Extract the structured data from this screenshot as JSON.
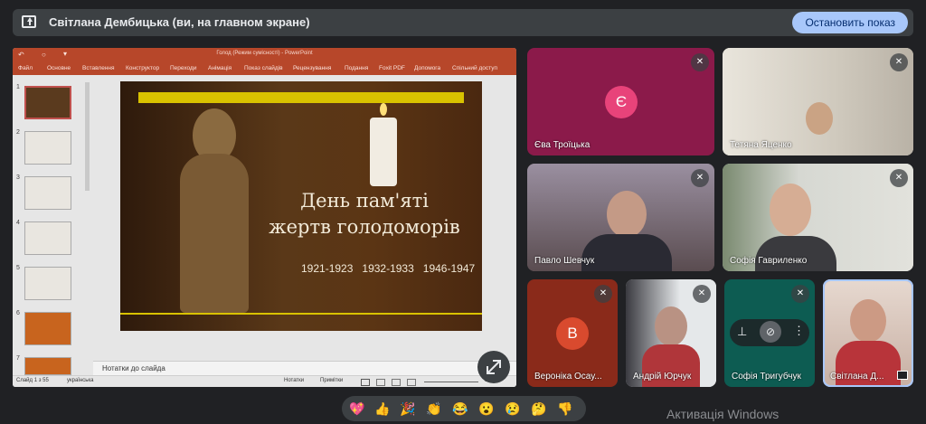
{
  "banner": {
    "text": "Світлана Дембицька (ви, на главном экране)",
    "stop_label": "Остановить показ"
  },
  "ppt": {
    "title": "Голод (Режим сумісності) - PowerPoint",
    "menu": [
      "Файл",
      "Основне",
      "Вставлення",
      "Конструктор",
      "Переходи",
      "Анімація",
      "Показ слайдів",
      "Рецензування",
      "Подання",
      "Foxit PDF",
      "Допомога",
      "Спільний доступ"
    ],
    "thumb_numbers": [
      "1",
      "2",
      "3",
      "4",
      "5",
      "6",
      "7"
    ],
    "notes_placeholder": "Нотатки до слайда",
    "status": {
      "slide_counter": "Слайд 1 з 55",
      "language": "українська",
      "notes_btn": "Нотатки",
      "comments_btn": "Примітки",
      "zoom": "52 %"
    },
    "slide": {
      "title_line1": "День пам'яті",
      "title_line2": "жертв голодоморів",
      "years": "1921-1923   1932-1933   1946-1947"
    }
  },
  "participants": [
    {
      "name": "Єва Троїцька",
      "initial": "Є",
      "muted": true
    },
    {
      "name": "Тетяна Яценко",
      "muted": true
    },
    {
      "name": "Павло Шевчук",
      "muted": true
    },
    {
      "name": "Софія Гавриленко",
      "muted": true
    },
    {
      "name": "Вероніка Осау...",
      "initial": "В",
      "muted": true
    },
    {
      "name": "Андрій Юрчук",
      "muted": true
    },
    {
      "name": "Софія Тригубчук",
      "muted": true
    },
    {
      "name": "Світлана Д...",
      "muted": false
    }
  ],
  "reactions": [
    "💖",
    "👍",
    "🎉",
    "👏",
    "😂",
    "😮",
    "😢",
    "🤔",
    "👎"
  ],
  "watermark": "Активація Windows",
  "colors": {
    "accent": "#a8c7fa",
    "ppt_brand": "#b7472a",
    "tile_pink": "#8b1a4a",
    "tile_teal": "#0d5c52",
    "tile_red": "#8a2a1a"
  }
}
